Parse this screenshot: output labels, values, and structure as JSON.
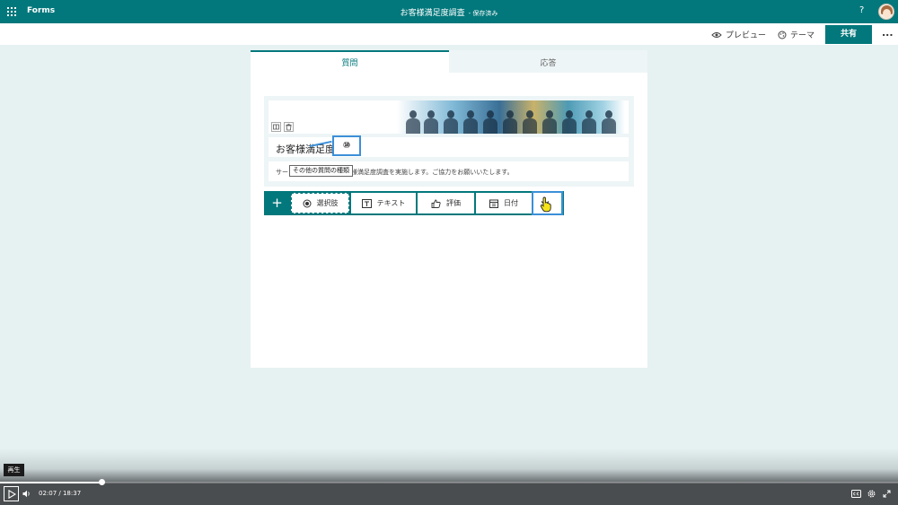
{
  "topbar": {
    "app_name": "Forms",
    "doc_title": "お客様満足度調査",
    "save_status": "- 保存済み",
    "help": "?"
  },
  "commandbar": {
    "preview": "プレビュー",
    "theme": "テーマ",
    "share": "共有",
    "more": "..."
  },
  "tabs": {
    "questions": "質問",
    "responses": "応答"
  },
  "form": {
    "title": "お客様満足度調査",
    "description": "サービス向上を目的にお客様満足度調査を実施します。ご協力をお願いいたします。"
  },
  "question_toolbar": {
    "add": "+",
    "choice": "選択肢",
    "text": "テキスト",
    "rating": "評価",
    "date": "日付",
    "more_tooltip": "その他の質問の種類"
  },
  "callout": {
    "label": "⑩"
  },
  "player": {
    "play_tooltip": "再生",
    "time": "02:07 / 18:37",
    "progress_fraction": 0.1137
  },
  "colors": {
    "brand": "#03787c",
    "background": "#e6f1f2",
    "highlight": "#3c8fd8"
  }
}
